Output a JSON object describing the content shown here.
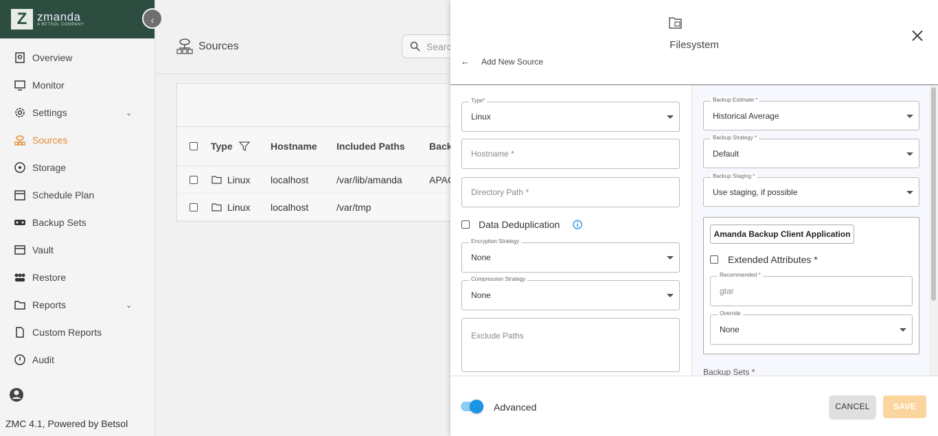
{
  "sidebar": {
    "brand": "zmanda",
    "brand_sub": "A BETSOL COMPANY",
    "collapse_icon": "chevron-left-icon",
    "items": [
      {
        "label": "Overview",
        "icon": "overview-icon"
      },
      {
        "label": "Monitor",
        "icon": "monitor-icon"
      },
      {
        "label": "Settings",
        "icon": "gear-icon",
        "has_children": true
      },
      {
        "label": "Sources",
        "icon": "sources-icon",
        "active": true
      },
      {
        "label": "Storage",
        "icon": "storage-icon"
      },
      {
        "label": "Schedule Plan",
        "icon": "calendar-icon"
      },
      {
        "label": "Backup Sets",
        "icon": "backup-sets-icon"
      },
      {
        "label": "Vault",
        "icon": "vault-icon"
      },
      {
        "label": "Restore",
        "icon": "restore-icon"
      },
      {
        "label": "Reports",
        "icon": "reports-icon",
        "has_children": true
      },
      {
        "label": "Custom Reports",
        "icon": "custom-reports-icon"
      },
      {
        "label": "Audit",
        "icon": "audit-icon"
      }
    ],
    "footer": "ZMC 4.1, Powered by Betsol",
    "active_color": "#e58a2c",
    "brand_color": "#2d4d40"
  },
  "main": {
    "title": "Sources",
    "search_placeholder": "Searc",
    "table": {
      "headers": [
        "Type",
        "Hostname",
        "Included Paths",
        "Back"
      ],
      "rows": [
        {
          "type": "Linux",
          "hostname": "localhost",
          "paths": "/var/lib/amanda",
          "backup": "APAC"
        },
        {
          "type": "Linux",
          "hostname": "localhost",
          "paths": "/var/tmp",
          "backup": ""
        }
      ]
    }
  },
  "panel": {
    "title": "Filesystem",
    "back_label": "Add New Source",
    "left": {
      "type": {
        "label": "Type*",
        "value": "Linux"
      },
      "hostname": {
        "placeholder": "Hostname *"
      },
      "directory": {
        "placeholder": "Directory Path *"
      },
      "dedup_label": "Data Deduplication",
      "encryption": {
        "label": "Encryption Strategy",
        "value": "None"
      },
      "compression": {
        "label": "Compression Strategy",
        "value": "None"
      },
      "exclude": {
        "placeholder": "Exclude Paths"
      }
    },
    "right": {
      "estimate": {
        "label": "Backup Estimate *",
        "value": "Historical Average"
      },
      "strategy": {
        "label": "Backup Strategy *",
        "value": "Default"
      },
      "staging": {
        "label": "Backup Staging *",
        "value": "Use staging, if possible"
      },
      "client_app": "Amanda Backup Client Application",
      "ext_attr_label": "Extended Attributes *",
      "recommended": {
        "label": "Recommended *",
        "value": "gtar"
      },
      "override": {
        "label": "Override",
        "value": "None"
      },
      "backup_sets_label": "Backup Sets *"
    },
    "footer": {
      "advanced_label": "Advanced",
      "advanced_on": true,
      "cancel_label": "CANCEL",
      "save_label": "SAVE"
    }
  }
}
